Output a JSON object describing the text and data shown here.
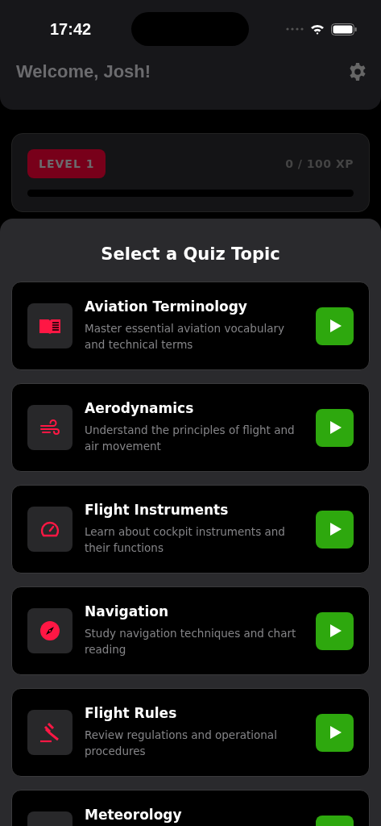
{
  "status_bar": {
    "time": "17:42"
  },
  "header": {
    "greeting": "Welcome, Josh!"
  },
  "progress": {
    "level_label": "LEVEL 1",
    "xp": "0 / 100 XP",
    "level": 0
  },
  "quiz": {
    "title": "Select a Quiz Topic",
    "topics": [
      {
        "kind": "book",
        "title": "Aviation Terminology",
        "description": "Master essential aviation vocabulary and technical terms"
      },
      {
        "kind": "wind",
        "title": "Aerodynamics",
        "description": "Understand the principles of flight and air movement"
      },
      {
        "kind": "gauge",
        "title": "Flight Instruments",
        "description": "Learn about cockpit instruments and their functions"
      },
      {
        "kind": "compass",
        "title": "Navigation",
        "description": "Study navigation techniques and chart reading"
      },
      {
        "kind": "gavel",
        "title": "Flight Rules",
        "description": "Review regulations and operational procedures"
      },
      {
        "title": "Meteorology"
      }
    ]
  }
}
